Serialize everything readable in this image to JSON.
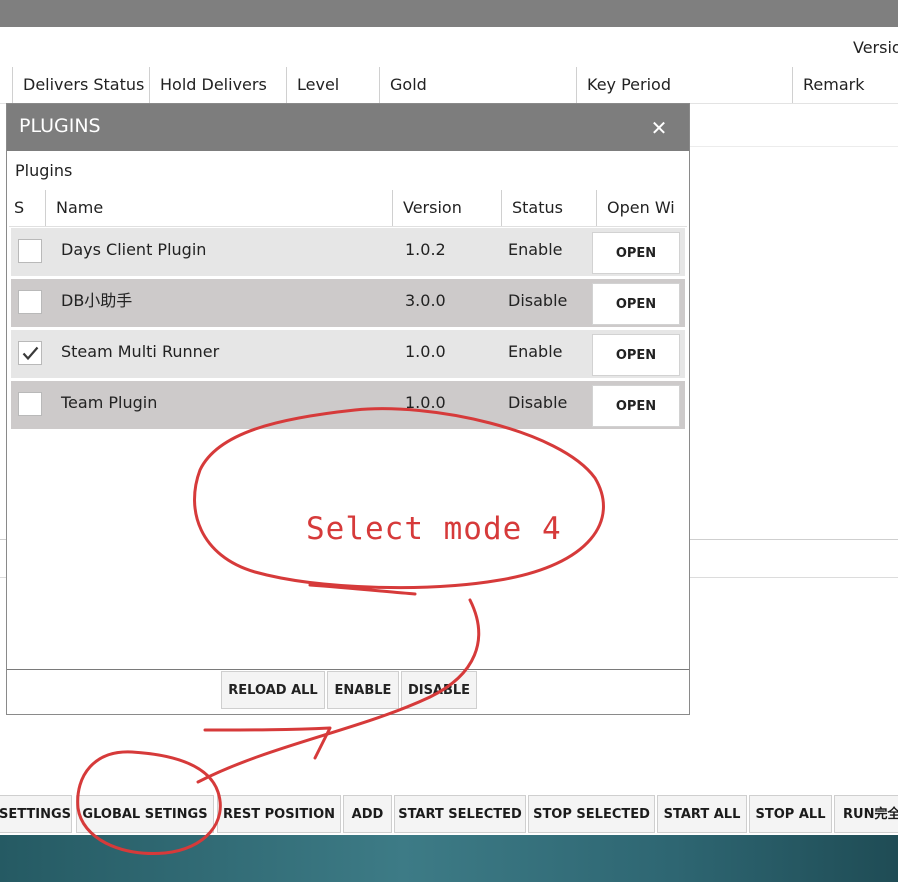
{
  "app": {
    "version_label": "Versio",
    "columns": [
      "Delivers Status",
      "Hold Delivers",
      "Level",
      "Gold",
      "Key Period",
      "Remark"
    ]
  },
  "toolbar": {
    "buttons": [
      "SETTINGS",
      "GLOBAL SETINGS",
      "REST POSITION",
      "ADD",
      "START SELECTED",
      "STOP SELECTED",
      "START ALL",
      "STOP ALL",
      "RUN完全"
    ]
  },
  "plugins_dialog": {
    "title": "PLUGINS",
    "close_glyph": "✕",
    "section_label": "Plugins",
    "columns": [
      "S",
      "Name",
      "Version",
      "Status",
      "Open Wi"
    ],
    "rows": [
      {
        "checked": false,
        "name": "Days Client Plugin",
        "version": "1.0.2",
        "status": "Enable",
        "open_label": "OPEN"
      },
      {
        "checked": false,
        "name": "DB小助手",
        "version": "3.0.0",
        "status": "Disable",
        "open_label": "OPEN"
      },
      {
        "checked": true,
        "name": "Steam Multi Runner",
        "version": "1.0.0",
        "status": "Enable",
        "open_label": "OPEN"
      },
      {
        "checked": false,
        "name": "Team Plugin",
        "version": "1.0.0",
        "status": "Disable",
        "open_label": "OPEN"
      }
    ],
    "footer_buttons": [
      "RELOAD ALL",
      "ENABLE",
      "DISABLE"
    ]
  },
  "annotation": {
    "text": "Select mode 4",
    "color": "#d63a3a"
  },
  "icons": {
    "close": "close-icon",
    "check": "check-icon"
  }
}
